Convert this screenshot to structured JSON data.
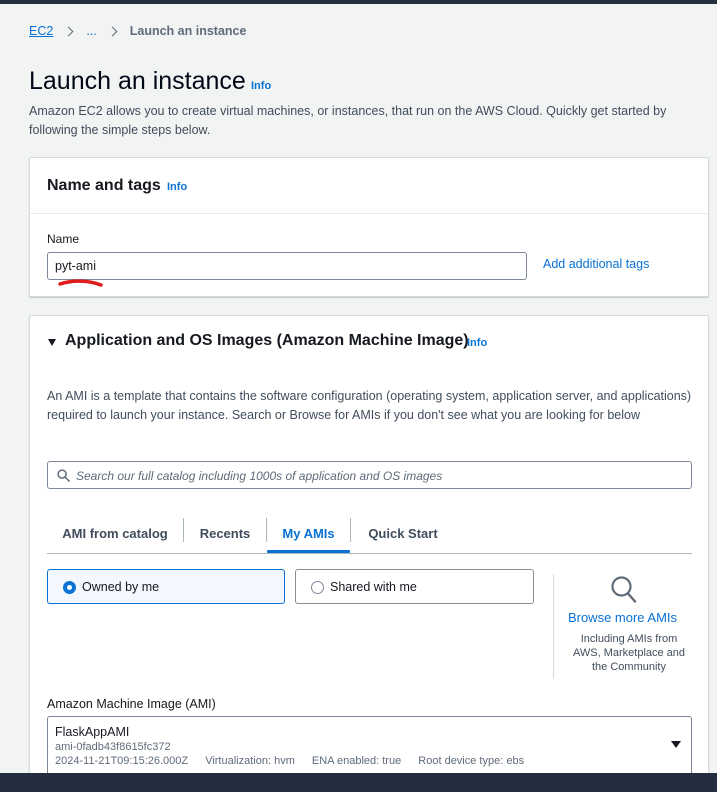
{
  "breadcrumb": {
    "root": "EC2",
    "ellipsis": "...",
    "current": "Launch an instance"
  },
  "page": {
    "title": "Launch an instance",
    "info": "Info",
    "description": "Amazon EC2 allows you to create virtual machines, or instances, that run on the AWS Cloud. Quickly get started by following the simple steps below."
  },
  "name_tags": {
    "heading": "Name and tags",
    "info": "Info",
    "name_label": "Name",
    "name_value": "pyt-ami",
    "add_tags": "Add additional tags"
  },
  "ami_section": {
    "heading": "Application and OS Images (Amazon Machine Image)",
    "info": "Info",
    "description": "An AMI is a template that contains the software configuration (operating system, application server, and applications) required to launch your instance. Search or Browse for AMIs if you don't see what you are looking for below",
    "search_placeholder": "Search our full catalog including 1000s of application and OS images",
    "tabs": [
      {
        "label": "AMI from catalog",
        "active": false
      },
      {
        "label": "Recents",
        "active": false
      },
      {
        "label": "My AMIs",
        "active": true
      },
      {
        "label": "Quick Start",
        "active": false
      }
    ],
    "ownership": [
      {
        "label": "Owned by me",
        "selected": true
      },
      {
        "label": "Shared with me",
        "selected": false
      }
    ],
    "browse": {
      "link": "Browse more AMIs",
      "description": "Including AMIs from AWS, Marketplace and the Community"
    },
    "ami_label": "Amazon Machine Image (AMI)",
    "selected_ami": {
      "name": "FlaskAppAMI",
      "id": "ami-0fadb43f8615fc372",
      "created": "2024-11-21T09:15:26.000Z",
      "virtualization": "Virtualization: hvm",
      "ena": "ENA enabled: true",
      "root_device": "Root device type: ebs"
    }
  },
  "colors": {
    "accent": "#0972d3",
    "annotation": "#e01b1b",
    "header_dark": "#232f3e"
  }
}
